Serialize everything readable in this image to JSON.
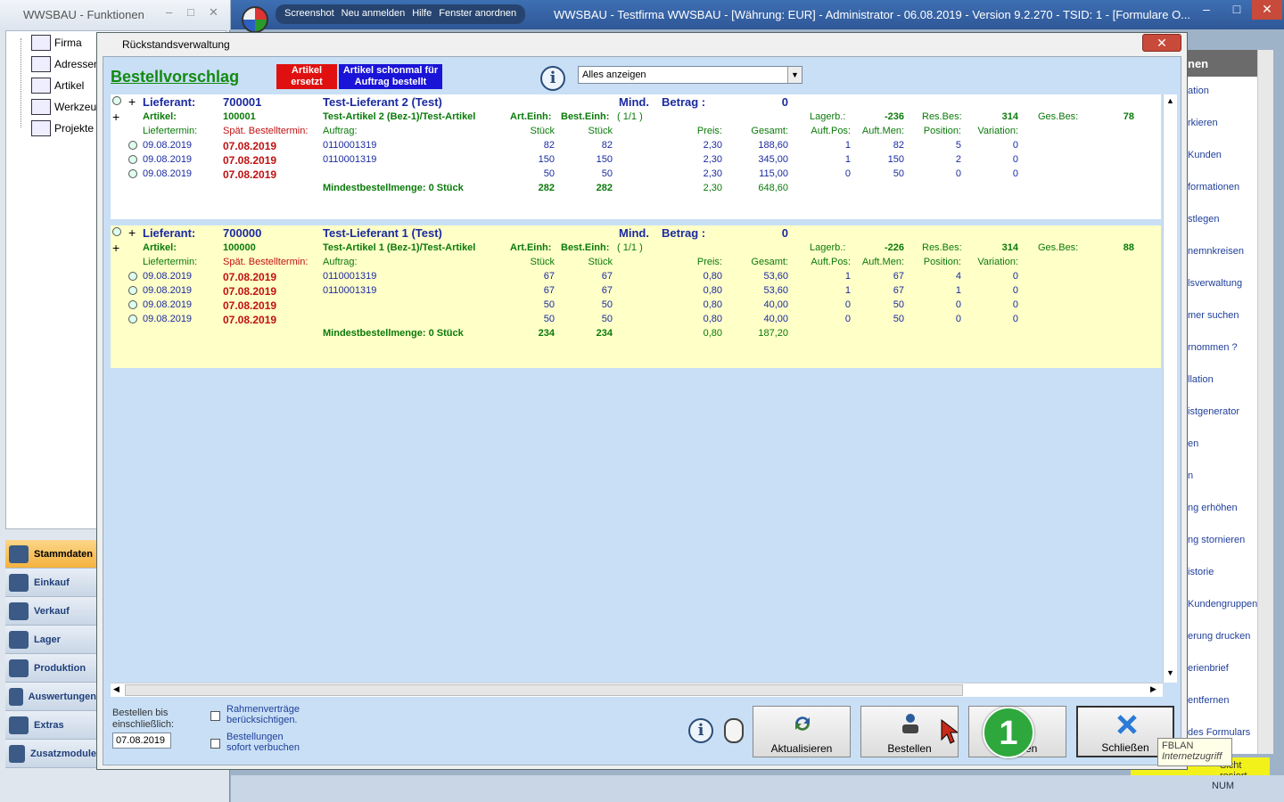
{
  "funcwin": {
    "title": "WWSBAU - Funktionen",
    "tree": [
      "Firma",
      "Adressen",
      "Artikel",
      "Werkzeuge",
      "Projekte"
    ],
    "modules": [
      "Stammdaten",
      "Einkauf",
      "Verkauf",
      "Lager",
      "Produktion",
      "Auswertungen",
      "Extras",
      "Zusatzmodule"
    ]
  },
  "app": {
    "menu": [
      "Screenshot",
      "Neu anmelden",
      "Hilfe",
      "Fenster anordnen"
    ],
    "title": "WWSBAU - Testfirma WWSBAU - [Währung: EUR] - Administrator - 06.08.2019 - Version 9.2.270 - TSID: 1 - [Formulare O..."
  },
  "rightpanel": {
    "head": "nen",
    "items": [
      "ation",
      "rkieren",
      "Kunden",
      "formationen",
      "stlegen",
      "nemnkreisen",
      "lsverwaltung",
      "mer suchen",
      "rnommen ?",
      "llation",
      "istgenerator",
      "en",
      "n",
      "ng erhöhen",
      "ng stornieren",
      "istorie",
      "Kundengruppen",
      "erung drucken",
      "erienbrief",
      "entfernen",
      "des Formulars"
    ],
    "status_yellow": "Sicht resiert",
    "num": "NUM"
  },
  "dialog": {
    "title": "Rückstandsverwaltung",
    "header": "Bestellvorschlag",
    "legend_replaced": "Artikel ersetzt",
    "legend_ordered": "Artikel schonmal für Auftrag bestellt",
    "filter": "Alles anzeigen",
    "labels": {
      "lieferant": "Lieferant:",
      "mind": "Mind.",
      "betrag": "Betrag :",
      "artikel": "Artikel:",
      "arteinh": "Art.Einh:",
      "besteinh": "Best.Einh:",
      "lagerb": "Lagerb.:",
      "resbes": "Res.Bes:",
      "gesbes": "Ges.Bes:",
      "liefertermin": "Liefertermin:",
      "spaet": "Spät. Bestelltermin:",
      "auftrag": "Auftrag:",
      "stueck": "Stück",
      "preis": "Preis:",
      "gesamt": "Gesamt:",
      "auftpos": "Auft.Pos:",
      "auftmen": "Auft.Men:",
      "position": "Position:",
      "variation": "Variation:"
    },
    "groups": [
      {
        "lieferant_nr": "700001",
        "lieferant_name": "Test-Lieferant 2  (Test)",
        "betrag": "0",
        "artikel_nr": "100001",
        "artikel_name": "Test-Artikel 2  (Bez-1)/Test-Artikel",
        "einh": "( 1/1 )",
        "lagerb": "-236",
        "resbes": "314",
        "gesbes": "78",
        "rows": [
          {
            "lt": "09.08.2019",
            "sp": "07.08.2019",
            "auf": "0110001319",
            "s1": "82",
            "s2": "82",
            "preis": "2,30",
            "ges": "188,60",
            "ap": "1",
            "am": "82",
            "pos": "5",
            "var": "0"
          },
          {
            "lt": "09.08.2019",
            "sp": "07.08.2019",
            "auf": "0110001319",
            "s1": "150",
            "s2": "150",
            "preis": "2,30",
            "ges": "345,00",
            "ap": "1",
            "am": "150",
            "pos": "2",
            "var": "0"
          },
          {
            "lt": "09.08.2019",
            "sp": "07.08.2019",
            "auf": "",
            "s1": "50",
            "s2": "50",
            "preis": "2,30",
            "ges": "115,00",
            "ap": "0",
            "am": "50",
            "pos": "0",
            "var": "0"
          }
        ],
        "min": "Mindestbestellmenge: 0 Stück",
        "sum1": "282",
        "sum2": "282",
        "sump": "2,30",
        "sumg": "648,60"
      },
      {
        "lieferant_nr": "700000",
        "lieferant_name": "Test-Lieferant 1  (Test)",
        "betrag": "0",
        "artikel_nr": "100000",
        "artikel_name": "Test-Artikel 1  (Bez-1)/Test-Artikel",
        "einh": "( 1/1 )",
        "lagerb": "-226",
        "resbes": "314",
        "gesbes": "88",
        "rows": [
          {
            "lt": "09.08.2019",
            "sp": "07.08.2019",
            "auf": "0110001319",
            "s1": "67",
            "s2": "67",
            "preis": "0,80",
            "ges": "53,60",
            "ap": "1",
            "am": "67",
            "pos": "4",
            "var": "0"
          },
          {
            "lt": "09.08.2019",
            "sp": "07.08.2019",
            "auf": "0110001319",
            "s1": "67",
            "s2": "67",
            "preis": "0,80",
            "ges": "53,60",
            "ap": "1",
            "am": "67",
            "pos": "1",
            "var": "0"
          },
          {
            "lt": "09.08.2019",
            "sp": "07.08.2019",
            "auf": "",
            "s1": "50",
            "s2": "50",
            "preis": "0,80",
            "ges": "40,00",
            "ap": "0",
            "am": "50",
            "pos": "0",
            "var": "0"
          },
          {
            "lt": "09.08.2019",
            "sp": "07.08.2019",
            "auf": "",
            "s1": "50",
            "s2": "50",
            "preis": "0,80",
            "ges": "40,00",
            "ap": "0",
            "am": "50",
            "pos": "0",
            "var": "0"
          }
        ],
        "min": "Mindestbestellmenge: 0 Stück",
        "sum1": "234",
        "sum2": "234",
        "sump": "0,80",
        "sumg": "187,20"
      }
    ],
    "bottom": {
      "order_until": "Bestellen bis einschließlich:",
      "date": "07.08.2019",
      "cb1": "Rahmenverträge berücksichtigen.",
      "cb2": "Bestellungen sofort verbuchen",
      "btn_refresh": "Aktualisieren",
      "btn_order": "Bestellen",
      "btn_print": "Drucken",
      "btn_close": "Schließen",
      "badge": "1",
      "tooltip1": "FBLAN",
      "tooltip2": "Internetzugriff"
    }
  }
}
